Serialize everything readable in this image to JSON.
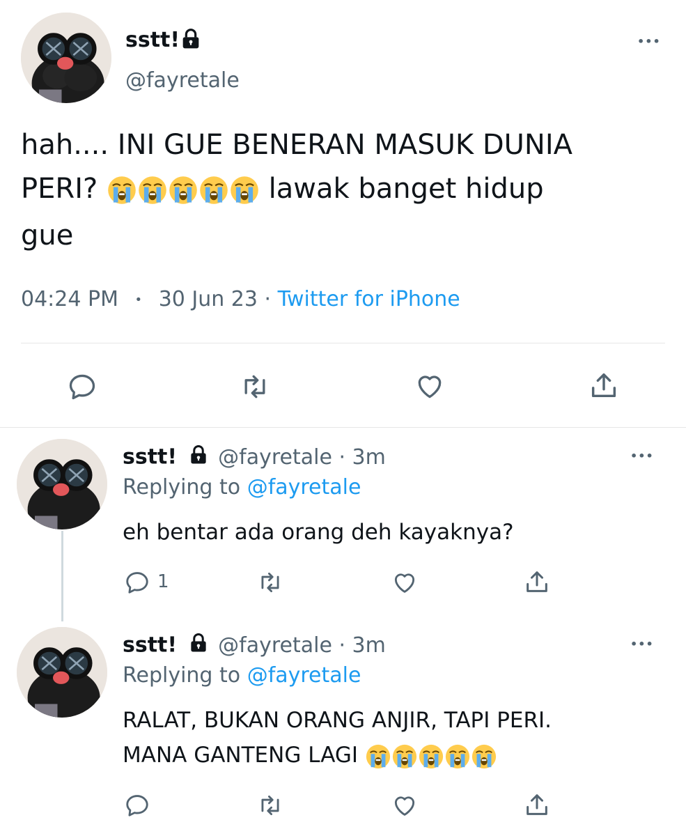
{
  "main_tweet": {
    "display_name": "sstt!",
    "handle": "@fayretale",
    "text_line1": "hah.... INI GUE BENERAN MASUK DUNIA",
    "text_line2_prefix": "PERI?",
    "text_line2_suffix": "lawak banget hidup",
    "text_line3": "gue",
    "emoji_count": 5,
    "time": "04:24 PM",
    "dot": "•",
    "date": "30 Jun 23",
    "sep": "·",
    "source": "Twitter for iPhone"
  },
  "replies": [
    {
      "display_name": "sstt!",
      "handle_time": "@fayretale · 3m",
      "replying_prefix": "Replying to",
      "replying_to": "@fayretale",
      "text_line1": "eh bentar ada orang deh kayaknya?",
      "reply_count": "1"
    },
    {
      "display_name": "sstt!",
      "handle_time": "@fayretale · 3m",
      "replying_prefix": "Replying to",
      "replying_to": "@fayretale",
      "text_line1": "RALAT, BUKAN ORANG ANJIR, TAPI PERI.",
      "text_line2": "MANA GANTENG LAGI",
      "emoji_count": 5
    }
  ],
  "more_label": "•••",
  "icons": {
    "reply": "reply-icon",
    "retweet": "retweet-icon",
    "like": "heart-icon",
    "share": "share-icon",
    "lock": "lock-icon",
    "more": "more-icon"
  },
  "colors": {
    "link": "#1d9bf0",
    "muted": "#536471",
    "text": "#0f1419"
  }
}
